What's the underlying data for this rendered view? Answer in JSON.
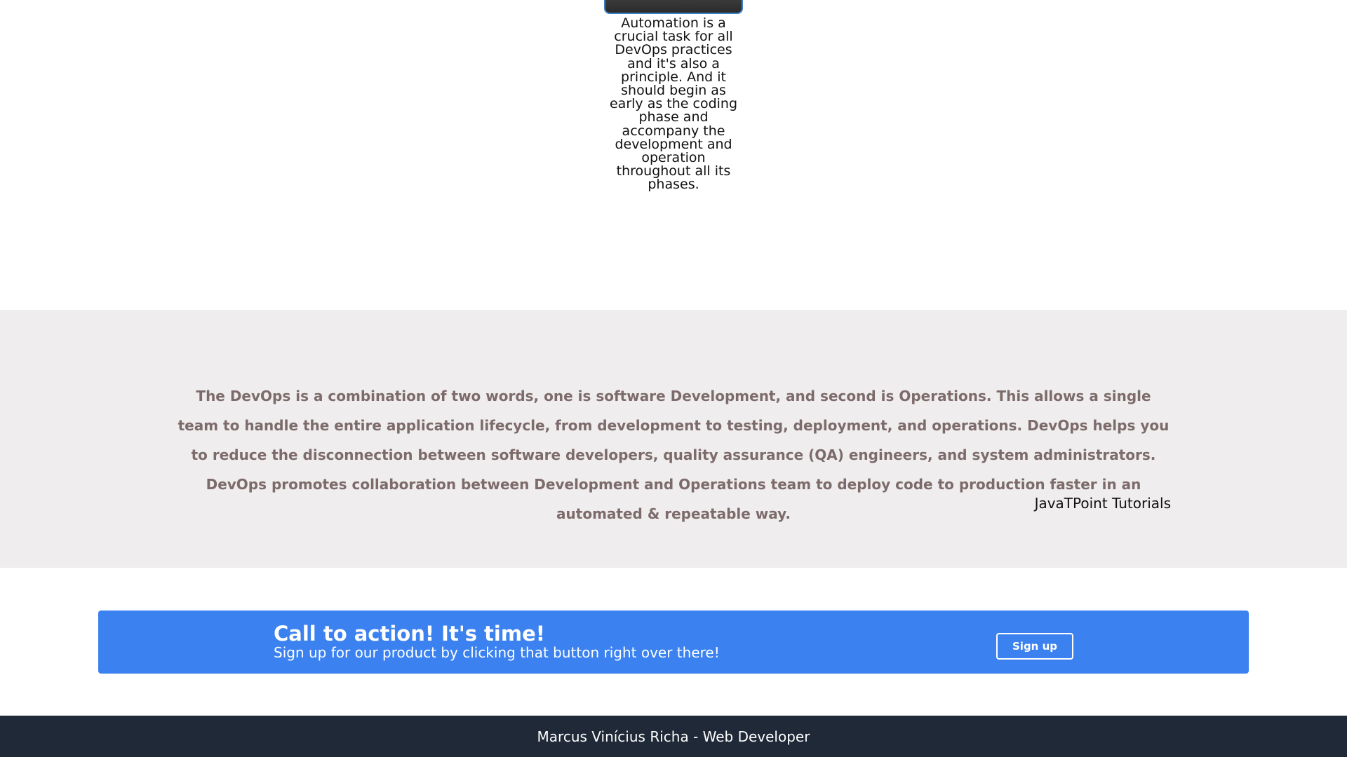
{
  "card": {
    "text": "Automation is a crucial task for all DevOps practices and it's also a principle. And it should begin as early as the coding phase and accompany the development and operation throughout all its phases."
  },
  "quote": {
    "text": "The DevOps is a combination of two words, one is software Development, and second is Operations. This allows a single team to handle the entire application lifecycle, from development to testing, deployment, and operations. DevOps helps you to reduce the disconnection between software developers, quality assurance (QA) engineers, and system administrators. DevOps promotes collaboration between Development and Operations team to deploy code to production faster in an automated & repeatable way.",
    "source": "JavaTPoint Tutorials"
  },
  "cta": {
    "title": "Call to action! It's time!",
    "subtitle": "Sign up for our product by clicking that button right over there!",
    "button_label": "Sign up"
  },
  "footer": {
    "text": "Marcus Vinícius Richa - Web Developer"
  },
  "colors": {
    "cta_background": "#3b82f0",
    "quote_background": "#efedee",
    "quote_text": "#7d6b6b",
    "footer_background": "#1f2937"
  }
}
